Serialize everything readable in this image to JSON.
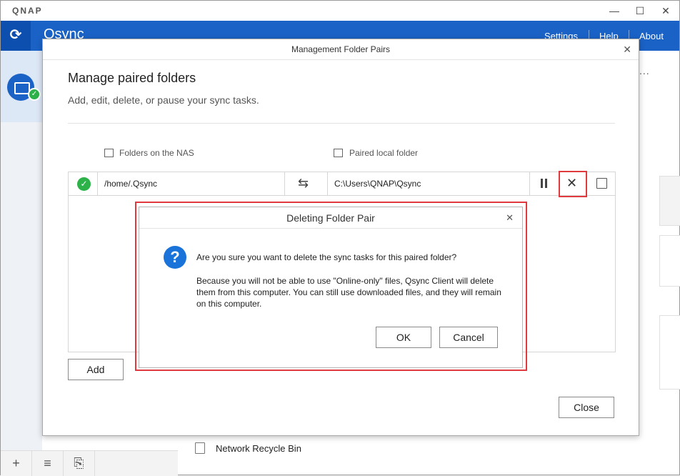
{
  "app": {
    "brand": "QNAP",
    "name": "Qsync",
    "header_links": {
      "settings": "Settings",
      "help": "Help",
      "about": "About"
    },
    "window_controls": {
      "minimize": "—",
      "maximize": "☐",
      "close": "✕"
    },
    "recycle_bin": "Network Recycle Bin",
    "more": "..."
  },
  "management": {
    "title": "Management Folder Pairs",
    "heading": "Manage paired folders",
    "subtitle": "Add, edit, delete, or pause your sync tasks.",
    "col_nas": "Folders on the NAS",
    "col_local": "Paired local folder",
    "pairs": [
      {
        "nas_path": "/home/.Qsync",
        "local_path": "C:\\Users\\QNAP\\Qsync",
        "status": "synced"
      }
    ],
    "add_label": "Add",
    "close_label": "Close"
  },
  "confirm": {
    "title": "Deleting Folder Pair",
    "question": "Are you sure you want to delete the sync tasks for this paired folder?",
    "detail": "Because you will not be able to use \"Online-only\" files, Qsync Client will delete them from this computer. You can still use downloaded files, and they will remain on this computer.",
    "ok_label": "OK",
    "cancel_label": "Cancel"
  },
  "colors": {
    "brand_blue": "#1a62c6",
    "success_green": "#2db24a",
    "highlight_red": "#e0393e"
  }
}
